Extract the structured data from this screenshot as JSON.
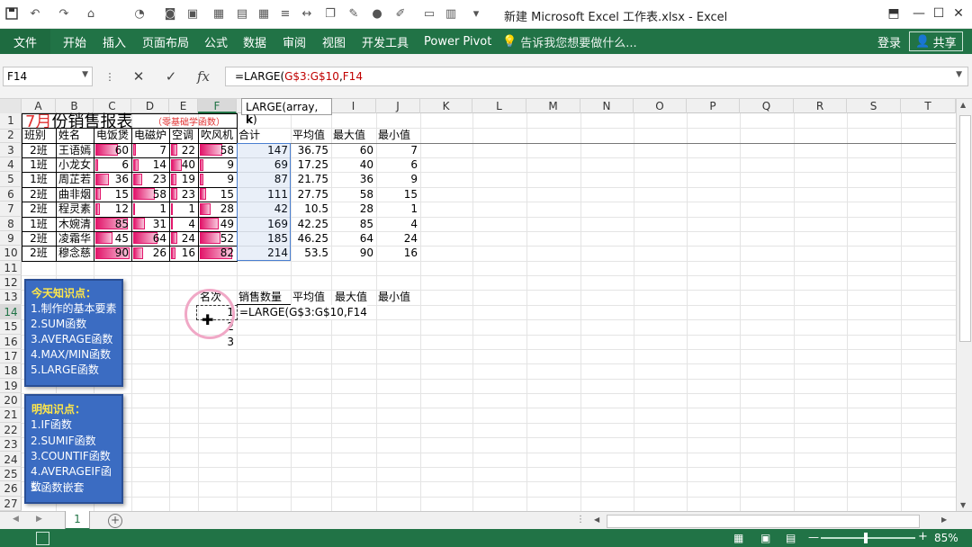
{
  "window": {
    "title": "新建 Microsoft Excel 工作表.xlsx - Excel"
  },
  "ribbon": {
    "file": "文件",
    "tabs": [
      "开始",
      "插入",
      "页面布局",
      "公式",
      "数据",
      "审阅",
      "视图",
      "开发工具",
      "Power Pivot"
    ],
    "tell_me": "告诉我您想要做什么...",
    "login": "登录",
    "share": "共享"
  },
  "formula_bar": {
    "name_box": "F14",
    "formula_prefix": "=LARGE(",
    "formula_range": "G$3:G$10",
    "formula_sep": ",",
    "formula_arg": "F14"
  },
  "tooltip": {
    "text": "LARGE(array, ",
    "bold": "k",
    "end": ")"
  },
  "columns": [
    "A",
    "B",
    "C",
    "D",
    "E",
    "F",
    "G",
    "H",
    "I",
    "J",
    "K",
    "L",
    "M",
    "N",
    "O",
    "P",
    "Q",
    "R",
    "S",
    "T"
  ],
  "rows": [
    "1",
    "2",
    "3",
    "4",
    "5",
    "6",
    "7",
    "8",
    "9",
    "10",
    "11",
    "12",
    "13",
    "14",
    "15",
    "16",
    "17",
    "18",
    "19",
    "20",
    "21",
    "22",
    "23",
    "24",
    "25",
    "26",
    "27"
  ],
  "sheet": {
    "title_month": "7月",
    "title_rest": "份销售报表",
    "title_note": "（零基础学函数）",
    "headers": [
      "班别",
      "姓名",
      "电饭煲",
      "电磁炉",
      "空调",
      "吹风机",
      "合计",
      "平均值",
      "最大值",
      "最小值"
    ],
    "data": [
      [
        "2班",
        "王语嫣",
        60,
        7,
        22,
        58,
        147,
        "36.75",
        60,
        7
      ],
      [
        "1班",
        "小龙女",
        6,
        14,
        40,
        9,
        69,
        "17.25",
        40,
        6
      ],
      [
        "1班",
        "周芷若",
        36,
        23,
        19,
        9,
        87,
        "21.75",
        36,
        9
      ],
      [
        "2班",
        "曲非烟",
        15,
        58,
        23,
        15,
        111,
        "27.75",
        58,
        15
      ],
      [
        "2班",
        "程灵素",
        12,
        1,
        1,
        28,
        42,
        "10.5",
        28,
        1
      ],
      [
        "1班",
        "木婉清",
        85,
        31,
        4,
        49,
        169,
        "42.25",
        85,
        4
      ],
      [
        "2班",
        "凌霜华",
        45,
        64,
        24,
        52,
        185,
        "46.25",
        64,
        24
      ],
      [
        "2班",
        "穆念慈",
        90,
        26,
        16,
        82,
        214,
        "53.5",
        90,
        16
      ]
    ],
    "bar_max": 90,
    "rank_headers": [
      "名次",
      "销售数量",
      "平均值",
      "最大值",
      "最小值"
    ],
    "ranks": [
      "1",
      "2",
      "3"
    ],
    "editing_formula": "=LARGE(G$3:G$10,F14"
  },
  "panel1": {
    "title": "今天知识点：",
    "items": [
      "1.制作的基本要素",
      "2.SUM函数",
      "3.AVERAGE函数",
      "4.MAX/MIN函数",
      "5.LARGE函数"
    ]
  },
  "panel2": {
    "title": "明知识点：",
    "items": [
      "1.IF函数",
      "2.SUMIF函数",
      "3.COUNTIF函数",
      "4.AVERAGEIF函数",
      "5.函数嵌套"
    ]
  },
  "sheet_tab": "1",
  "zoom": "85%"
}
